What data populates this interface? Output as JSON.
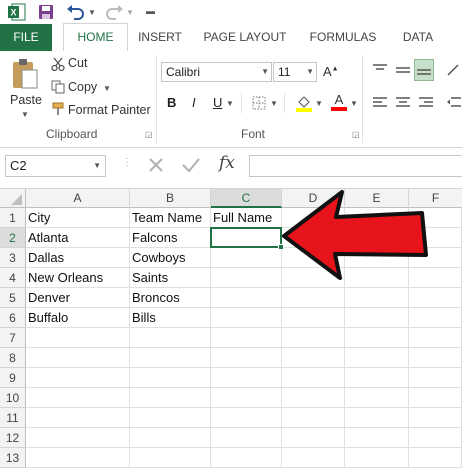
{
  "tabs": {
    "file": "FILE",
    "home": "HOME",
    "insert": "INSERT",
    "page_layout": "PAGE LAYOUT",
    "formulas": "FORMULAS",
    "data": "DATA"
  },
  "clipboard": {
    "paste": "Paste",
    "cut": "Cut",
    "copy": "Copy",
    "format_painter": "Format Painter",
    "group_label": "Clipboard"
  },
  "font": {
    "name": "Calibri",
    "size": "11",
    "bold": "B",
    "italic": "I",
    "underline": "U",
    "font_color_glyph": "A",
    "grow_glyph": "A",
    "group_label": "Font",
    "colors": {
      "highlight": "#ffff00",
      "font_color": "#ff0000"
    }
  },
  "formula_bar": {
    "name_box": "C2",
    "fx": "fx",
    "value": ""
  },
  "sheet": {
    "columns": [
      "A",
      "B",
      "C",
      "D",
      "E",
      "F"
    ],
    "rows": [
      "1",
      "2",
      "3",
      "4",
      "5",
      "6",
      "7",
      "8",
      "9",
      "10",
      "11",
      "12",
      "13"
    ],
    "cells": {
      "A1": "City",
      "B1": "Team Name",
      "C1": "Full Name",
      "A2": "Atlanta",
      "B2": "Falcons",
      "A3": "Dallas",
      "B3": "Cowboys",
      "A4": "New Orleans",
      "B4": "Saints",
      "A5": "Denver",
      "B5": "Broncos",
      "A6": "Buffalo",
      "B6": "Bills"
    },
    "active_cell": "C2",
    "accent": "#217346"
  },
  "annotation": {
    "arrow_color": "#e8141b"
  }
}
